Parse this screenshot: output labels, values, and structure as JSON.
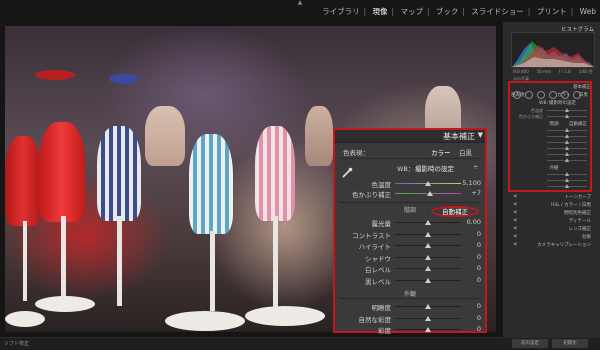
{
  "top_nav": {
    "modules": [
      "ライブラリ",
      "現像",
      "マップ",
      "ブック",
      "スライドショー",
      "プリント",
      "Web"
    ],
    "active_module": "現像"
  },
  "right_panel": {
    "histogram_label": "ヒストグラム",
    "hist_info": [
      "ISO 800",
      "50 mm",
      "f / 2.8",
      "1/60 秒"
    ],
    "hist_footer": "元の写真",
    "basic_header": "基本補正",
    "profile_label": "色表現：",
    "profile_options": [
      "カラー",
      "白黒"
    ],
    "wb_label": "WB：",
    "wb_value": "撮影時の設定",
    "temp_label": "色温度",
    "tint_label": "色かぶり補正",
    "tone_label": "階調",
    "auto_label": "自動補正",
    "presence_label": "外観",
    "panels": [
      "トーンカーブ",
      "HSL / カラー / 白黒",
      "明暗別色補正",
      "ディテール",
      "レンズ補正",
      "効果",
      "カメラキャリブレーション"
    ],
    "buttons": [
      "前の設定",
      "初期化"
    ]
  },
  "zoomed_panel": {
    "title": "基本補正",
    "profile_label": "色表現：",
    "color_option": "カラー",
    "bw_option": "白黒",
    "wb_label": "WB：",
    "wb_value": "撮影時の設定",
    "wb_arrows": "÷",
    "wb_sliders": [
      {
        "label": "色温度",
        "value": "5,100",
        "pos": 0.5
      },
      {
        "label": "色かぶり補正",
        "value": "+7",
        "pos": 0.53
      }
    ],
    "tone_title": "階調",
    "auto_label": "自動補正",
    "tone_sliders": [
      {
        "label": "露光量",
        "value": "0.00",
        "pos": 0.5
      },
      {
        "label": "コントラスト",
        "value": "0",
        "pos": 0.5
      },
      {
        "label": "ハイライト",
        "value": "0",
        "pos": 0.5
      },
      {
        "label": "シャドウ",
        "value": "0",
        "pos": 0.5
      },
      {
        "label": "白レベル",
        "value": "0",
        "pos": 0.5
      },
      {
        "label": "黒レベル",
        "value": "0",
        "pos": 0.5
      }
    ],
    "presence_title": "外観",
    "presence_sliders": [
      {
        "label": "明瞭度",
        "value": "0",
        "pos": 0.5
      },
      {
        "label": "自然な彩度",
        "value": "0",
        "pos": 0.5
      },
      {
        "label": "彩度",
        "value": "0",
        "pos": 0.5
      }
    ]
  },
  "bottom_bar": {
    "label": "ソフト校正",
    "buttons": [
      "前の設定",
      "初期化"
    ]
  },
  "colors": {
    "highlight_red": "#c4161c",
    "panel_bg": "#3a3a3a"
  }
}
